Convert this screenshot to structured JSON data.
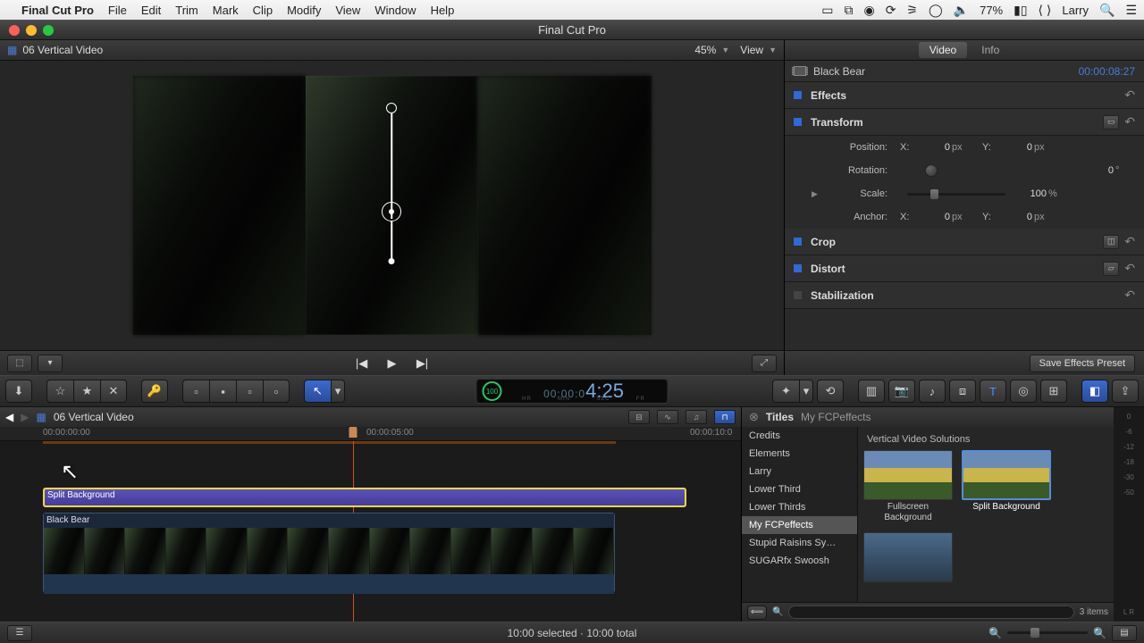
{
  "menubar": {
    "app": "Final Cut Pro",
    "items": [
      "File",
      "Edit",
      "Trim",
      "Mark",
      "Clip",
      "Modify",
      "View",
      "Window",
      "Help"
    ],
    "right": {
      "battery": "77%",
      "user": "Larry"
    }
  },
  "window": {
    "title": "Final Cut Pro"
  },
  "viewer": {
    "clip_title": "06 Vertical Video",
    "zoom": "45%",
    "view_label": "View"
  },
  "inspector": {
    "tabs": {
      "video": "Video",
      "info": "Info"
    },
    "clip_name": "Black Bear",
    "timecode": "00:00:08:27",
    "sections": {
      "effects": "Effects",
      "transform": "Transform",
      "crop": "Crop",
      "distort": "Distort",
      "stabilization": "Stabilization"
    },
    "transform": {
      "position_label": "Position:",
      "position": {
        "xlabel": "X:",
        "x": "0",
        "xunit": "px",
        "ylabel": "Y:",
        "y": "0",
        "yunit": "px"
      },
      "rotation_label": "Rotation:",
      "rotation": {
        "val": "0",
        "unit": "°"
      },
      "scale_label": "Scale:",
      "scale": {
        "val": "100",
        "unit": "%"
      },
      "anchor_label": "Anchor:",
      "anchor": {
        "xlabel": "X:",
        "x": "0",
        "xunit": "px",
        "ylabel": "Y:",
        "y": "0",
        "yunit": "px"
      }
    },
    "save_btn": "Save Effects Preset"
  },
  "toolstrip": {
    "tc_ring": "100",
    "tc_small": "00:00:0",
    "tc_big": "4:25",
    "tc_units": [
      "HR",
      "MIN",
      "SEC",
      "FR"
    ]
  },
  "timeline": {
    "project": "06 Vertical Video",
    "marks": {
      "t0": "00:00:00:00",
      "t5": "00:00:05:00",
      "t10": "00:00:10:0"
    },
    "clip_title_1": "Split Background",
    "clip_title_2": "Black Bear"
  },
  "browser": {
    "title": "Titles",
    "subtitle": "My FCPeffects",
    "sidebar": [
      "Credits",
      "Elements",
      "Larry",
      "Lower Third",
      "Lower Thirds",
      "My FCPeffects",
      "Stupid Raisins Sy…",
      "SUGARfx Swoosh"
    ],
    "category": "Vertical Video Solutions",
    "thumbs": [
      "Fullscreen Background",
      "Split Background"
    ],
    "count": "3 items"
  },
  "meters": {
    "ticks": [
      "0",
      "-6",
      "-12",
      "-18",
      "-30",
      "-50"
    ],
    "lr": "L   R"
  },
  "status": {
    "text": "10:00 selected · 10:00 total"
  }
}
